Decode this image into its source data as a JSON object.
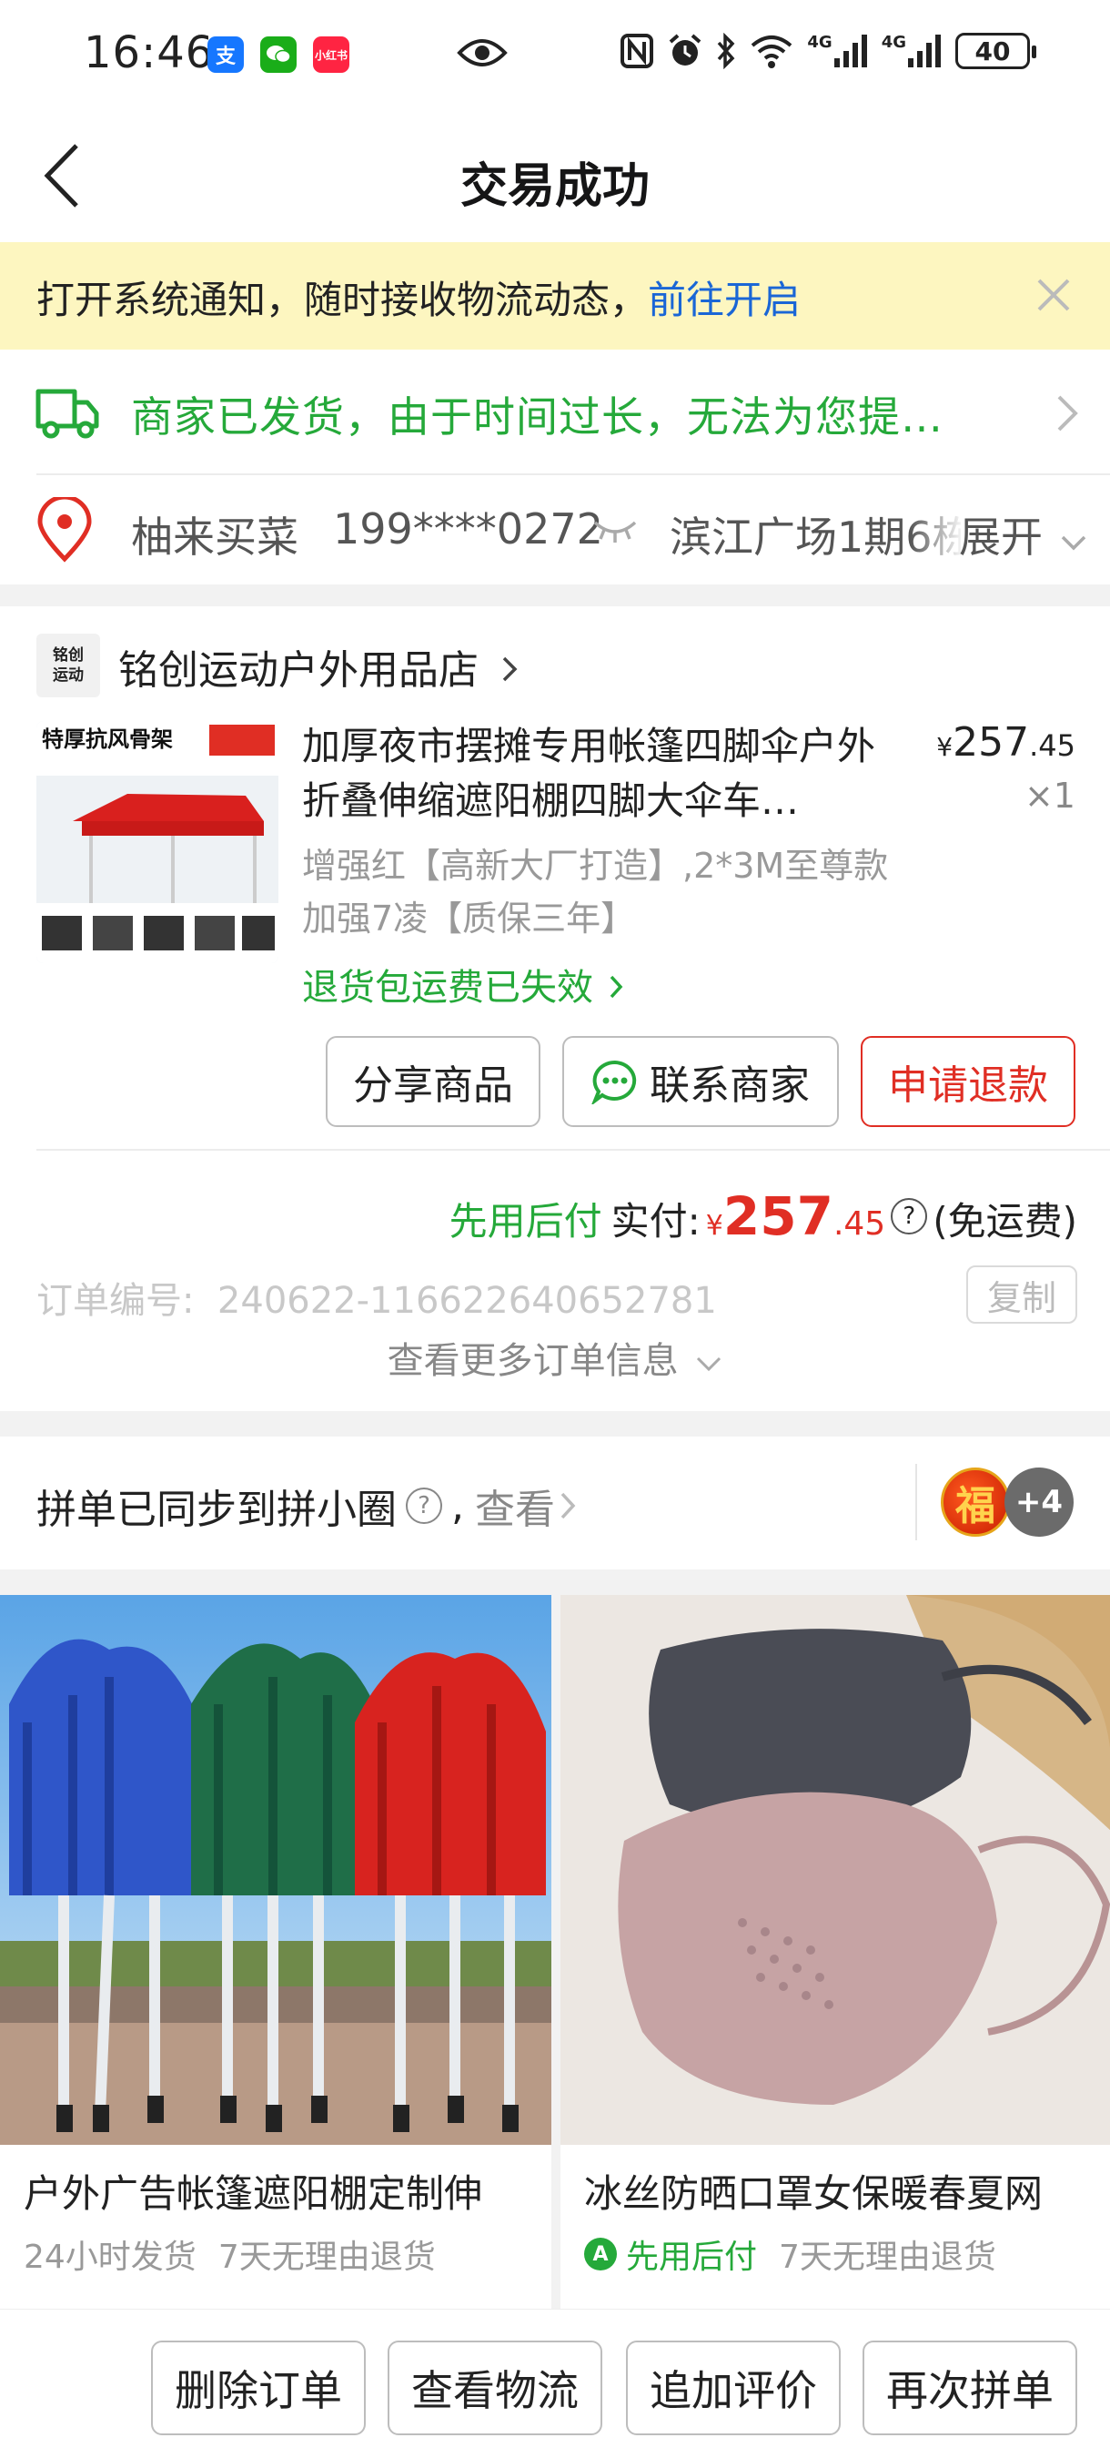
{
  "status_bar": {
    "time": "16:46",
    "apps": [
      {
        "name": "alipay-icon",
        "label": "支",
        "color": "#1677ff"
      },
      {
        "name": "wechat-icon",
        "label": "●",
        "color": "#1aad19"
      },
      {
        "name": "xiaohongshu-icon",
        "label": "小红书",
        "color": "#ff2442"
      }
    ],
    "battery": "40",
    "signal1": "4G",
    "signal2": "4G"
  },
  "nav": {
    "title": "交易成功"
  },
  "notice": {
    "text": "打开系统通知，随时接收物流动态，",
    "link": "前往开启"
  },
  "delivery": {
    "text": "商家已发货，由于时间过长，无法为您提…"
  },
  "address": {
    "name": "柚来买菜",
    "phone": "199****0272",
    "place": "滨江广场1期6栋",
    "expand": "展开"
  },
  "shop": {
    "logo_line1": "铭创",
    "logo_line2": "运动",
    "name": "铭创运动户外用品店"
  },
  "product": {
    "title": "加厚夜市摆摊专用帐篷四脚伞户外折叠伸缩遮阳棚四脚大伞车…",
    "price_symbol": "¥",
    "price_int": "257",
    "price_dec": ".45",
    "qty": "×1",
    "spec": "增强红【高新大厂打造】,2*3M至尊款加强7凌【质保三年】",
    "refund_note": "退货包运费已失效",
    "image_caption": "特厚抗风骨架"
  },
  "actions": {
    "share": "分享商品",
    "contact": "联系商家",
    "refund": "申请退款"
  },
  "payment": {
    "later": "先用后付",
    "label": "实付:",
    "symbol": "¥",
    "amount_int": "257",
    "amount_dec": ".45",
    "qmark": "?",
    "shipping": "(免运费)"
  },
  "order": {
    "number_label": "订单编号:",
    "number": "240622-116622640652781",
    "copy": "复制",
    "more": "查看更多订单信息"
  },
  "sync": {
    "text": "拼单已同步到拼小圈",
    "qmark": "?",
    "comma": ",",
    "look": "查看",
    "avatar1": "福",
    "avatar2": "+4"
  },
  "recommendations": [
    {
      "title": "户外广告帐篷遮阳棚定制伸",
      "tag1": "24小时发货",
      "tag2": "7天无理由退货"
    },
    {
      "title": "冰丝防晒口罩女保暖春夏网",
      "tag1": "先用后付",
      "tag2": "7天无理由退货",
      "badge": "A"
    }
  ],
  "bottom_bar": {
    "delete": "删除订单",
    "logistics": "查看物流",
    "review": "追加评价",
    "reorder": "再次拼单"
  },
  "colors": {
    "accent_red": "#e02e24",
    "green": "#25a93a",
    "link_blue": "#1a66d6",
    "notice_bg": "#fdf6c0"
  }
}
